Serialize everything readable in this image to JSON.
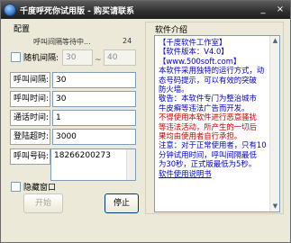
{
  "window": {
    "title": "千度呼死你试用版 - 购买请联系",
    "controls": {
      "minimize": "_",
      "close": "×"
    }
  },
  "config": {
    "group_label": "配置",
    "status_text": "呼叫间隔等待中...",
    "status_count": "24",
    "random_interval": {
      "label": "随机间隔:",
      "checked": false,
      "min": "30",
      "max": "40",
      "separator": "~"
    },
    "call_interval": {
      "label": "呼叫间隔:",
      "value": "30"
    },
    "call_time": {
      "label": "呼叫时间:",
      "value": "30"
    },
    "call_count": {
      "label": "通话时间:",
      "value": "1"
    },
    "login_timeout": {
      "label": "登陆超时:",
      "value": "3000"
    },
    "phone_number": {
      "label": "呼叫号码:",
      "value": "18266200273"
    },
    "hide_window": {
      "label": "隐藏窗口",
      "checked": false
    },
    "start_button": "开始",
    "stop_button": "停止"
  },
  "info": {
    "group_label": "软件介绍",
    "lines": [
      {
        "text": "【千度软件工作室】",
        "style": "blue"
      },
      {
        "text": "【软件版本：V4.0】",
        "style": "blue"
      },
      {
        "text": "【www.500soft.com】",
        "style": "blue"
      },
      {
        "text": "本软件采用独特的运行方式，动",
        "style": "blue"
      },
      {
        "text": "态号码提示，可以有效的突破",
        "style": "blue"
      },
      {
        "text": "防火墙。",
        "style": "blue"
      },
      {
        "text": "敬告：本软件专门为整治城市",
        "style": "blue"
      },
      {
        "text": "牛皮癣等违法广告而开发。",
        "style": "blue"
      },
      {
        "text": "不得使用本软件进行恶意骚扰",
        "style": "red"
      },
      {
        "text": "等违法活动，所产生的一切后",
        "style": "red"
      },
      {
        "text": "果均由使用者自行承担。",
        "style": "red"
      },
      {
        "text": "注意：对于正常使用者，只有10",
        "style": "blue"
      },
      {
        "text": "分钟试用时间，呼叫间隔最低",
        "style": "blue"
      },
      {
        "text": "为30秒，正式版最低为5秒。",
        "style": "blue"
      },
      {
        "text": "软件使用说明书",
        "style": "link"
      }
    ]
  }
}
